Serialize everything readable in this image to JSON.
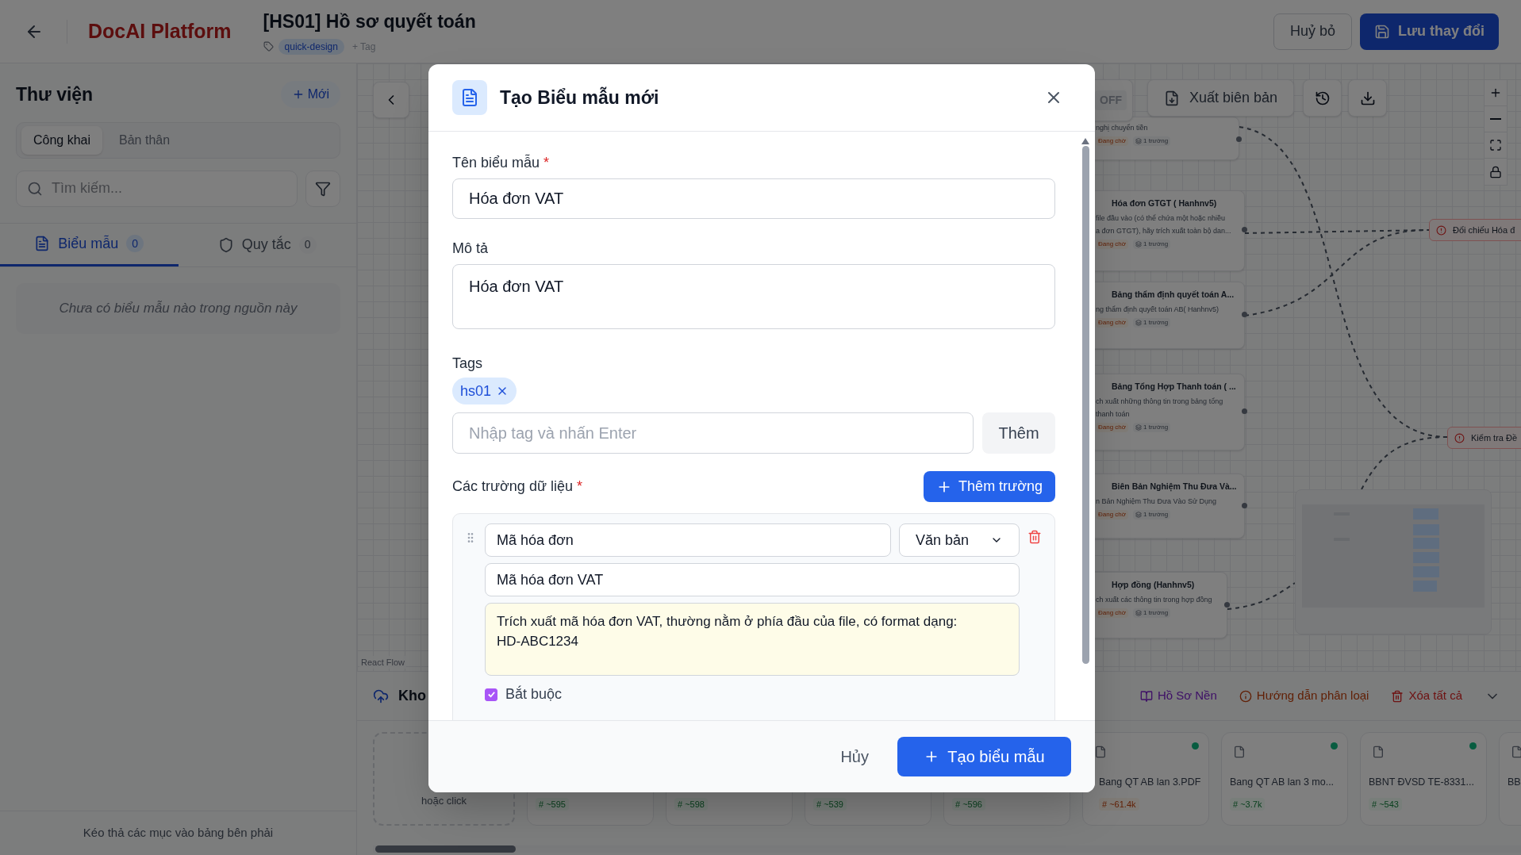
{
  "header": {
    "brand": "DocAI Platform",
    "title": "[HS01] Hồ sơ quyết toán",
    "tags": [
      "quick-design"
    ],
    "add_tag": "+ Tag",
    "cancel": "Huỷ bỏ",
    "save": "Lưu thay đổi"
  },
  "sidebar": {
    "title": "Thư viện",
    "new_button": "Mới",
    "scope_tabs": [
      {
        "label": "Công khai",
        "selected": true
      },
      {
        "label": "Bản thân",
        "selected": false
      }
    ],
    "search": {
      "placeholder": "Tìm kiếm..."
    },
    "tabs": [
      {
        "kind": "form",
        "label": "Biểu mẫu",
        "count": "0",
        "selected": true
      },
      {
        "kind": "rule",
        "label": "Quy tắc",
        "count": "0",
        "selected": false
      }
    ],
    "empty_message": "Chưa có biểu mẫu nào trong nguồn này",
    "footer": "Kéo thả các mục vào bảng bên phải"
  },
  "canvas": {
    "toggle": "OFF",
    "export": "Xuất biên bản",
    "attribution": "React Flow",
    "nodes": [
      {
        "description": [
          "nghị chuyển tiền"
        ],
        "status": "Đang chờ",
        "fields": "1 trường"
      },
      {
        "title": "Hóa đơn GTGT ( Hanhnv5)",
        "description": [
          "file đầu vào (có thể chứa một hoặc nhiều",
          "a đơn GTGT), hãy trích xuất toàn bộ dan..."
        ],
        "status": "Đang chờ",
        "fields": "1 trường"
      },
      {
        "title": "Bảng thẩm định quyết toán A...",
        "description": [
          "ng thẩm định quyết toán AB( Hanhnv5)"
        ],
        "status": "Đang chờ",
        "fields": "1 trường"
      },
      {
        "title": "Bảng Tổng Hợp Thanh toán ( ...",
        "description": [
          "ch xuất những thông tin trong bảng tổng",
          "thanh toán"
        ],
        "status": "Đang chờ",
        "fields": "1 trường"
      },
      {
        "title": "Biên Bản Nghiệm Thu Đưa Và...",
        "description": [
          "n Bản Nghiệm Thu Đưa Vào Sử Dụng"
        ],
        "status": "Đang chờ",
        "fields": "1 trường"
      },
      {
        "title": "Hợp đồng (Hanhnv5)",
        "description": [
          "ch xuất các thông tin trong hợp đồng"
        ],
        "status": "Đang chờ",
        "fields": "1 trường"
      }
    ],
    "rules": [
      {
        "label": "Đối chiếu Hóa đ"
      },
      {
        "label": "Kiểm tra Đề"
      }
    ]
  },
  "library_panel": {
    "title": "Kho",
    "drop_hint": "hoặc click",
    "actions": [
      {
        "kind": "background",
        "label": "Hồ Sơ Nền"
      },
      {
        "kind": "guide",
        "label": "Hướng dẫn phân loại"
      },
      {
        "kind": "clear",
        "label": "Xóa tất cả"
      }
    ],
    "files": [
      {
        "size": "# ~595",
        "kind": "normal"
      },
      {
        "size": "# ~598",
        "kind": "normal"
      },
      {
        "size": "# ~539",
        "kind": "normal"
      },
      {
        "size": "# ~596",
        "kind": "normal"
      },
      {
        "name": "Bang QT AB lan 3.PDF",
        "size": "# ~61.4k",
        "kind": "large"
      },
      {
        "name": "Bang QT AB lan 3 mo...",
        "size": "# ~3.7k",
        "kind": "normal"
      },
      {
        "name": "BBNT ĐVSD TE-8331...",
        "size": "# ~543",
        "kind": "normal"
      },
      {
        "name": "BB"
      }
    ]
  },
  "modal": {
    "title": "Tạo Biểu mẫu mới",
    "name": {
      "label": "Tên biểu mẫu",
      "required_mark": "*",
      "value": "Hóa đơn VAT"
    },
    "description": {
      "label": "Mô tả",
      "value": "Hóa đơn VAT"
    },
    "tags": {
      "label": "Tags",
      "items": [
        "hs01"
      ],
      "placeholder": "Nhập tag và nhấn Enter",
      "add_button": "Thêm"
    },
    "fields_section": {
      "label": "Các trường dữ liệu",
      "required_mark": "*",
      "add_button": "Thêm trường",
      "fields": [
        {
          "key": "Mã hóa đơn",
          "type": "Văn bản",
          "label": "Mã hóa đơn VAT",
          "instruction": "Trích xuất mã hóa đơn VAT, thường nằm ở phía đầu của file, có format dạng: HD-ABC1234",
          "required": true,
          "required_label": "Bắt buộc"
        }
      ]
    },
    "cancel": "Hủy",
    "submit": "Tạo biểu mẫu"
  }
}
